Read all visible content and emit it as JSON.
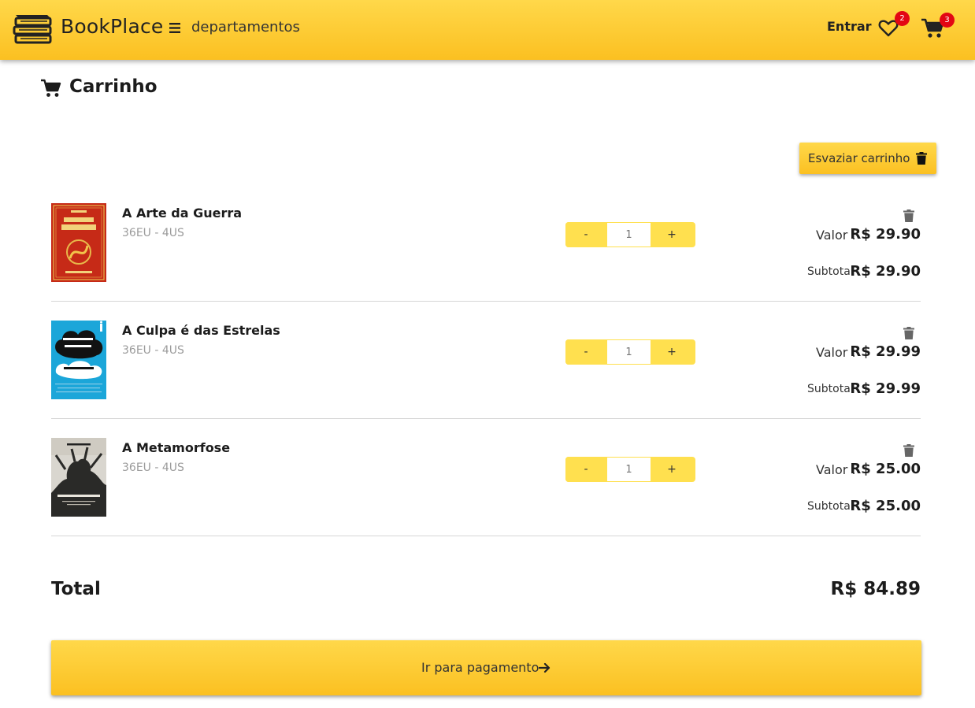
{
  "header": {
    "brand": "BookPlace",
    "menu_label": "departamentos",
    "login_label": "Entrar",
    "wishlist_count": "2",
    "cart_count": "3"
  },
  "page": {
    "title": "Carrinho",
    "empty_cart_label": "Esvaziar carrinho"
  },
  "items": [
    {
      "title": "A Arte da Guerra",
      "meta": "36EU - 4US",
      "quantity": "1",
      "minus": "-",
      "plus": "+",
      "valor_label": "Valor :",
      "valor": "R$ 29.90",
      "subtotal_label": "Subtotal",
      "subtotal": "R$ 29.90"
    },
    {
      "title": "A Culpa é das Estrelas",
      "meta": "36EU - 4US",
      "quantity": "1",
      "minus": "-",
      "plus": "+",
      "valor_label": "Valor :",
      "valor": "R$ 29.99",
      "subtotal_label": "Subtotal",
      "subtotal": "R$ 29.99"
    },
    {
      "title": "A Metamorfose",
      "meta": "36EU - 4US",
      "quantity": "1",
      "minus": "-",
      "plus": "+",
      "valor_label": "Valor :",
      "valor": "R$ 25.00",
      "subtotal_label": "Subtotal",
      "subtotal": "R$ 25.00"
    }
  ],
  "total": {
    "label": "Total",
    "value": "R$ 84.89"
  },
  "checkout": {
    "label": "Ir para pagamento"
  },
  "colors": {
    "accent": "#fcc928",
    "badge": "#e30613"
  },
  "icons": [
    "books-logo-icon",
    "hamburger-menu-icon",
    "heart-icon",
    "cart-icon",
    "trash-icon",
    "arrow-right-icon"
  ]
}
